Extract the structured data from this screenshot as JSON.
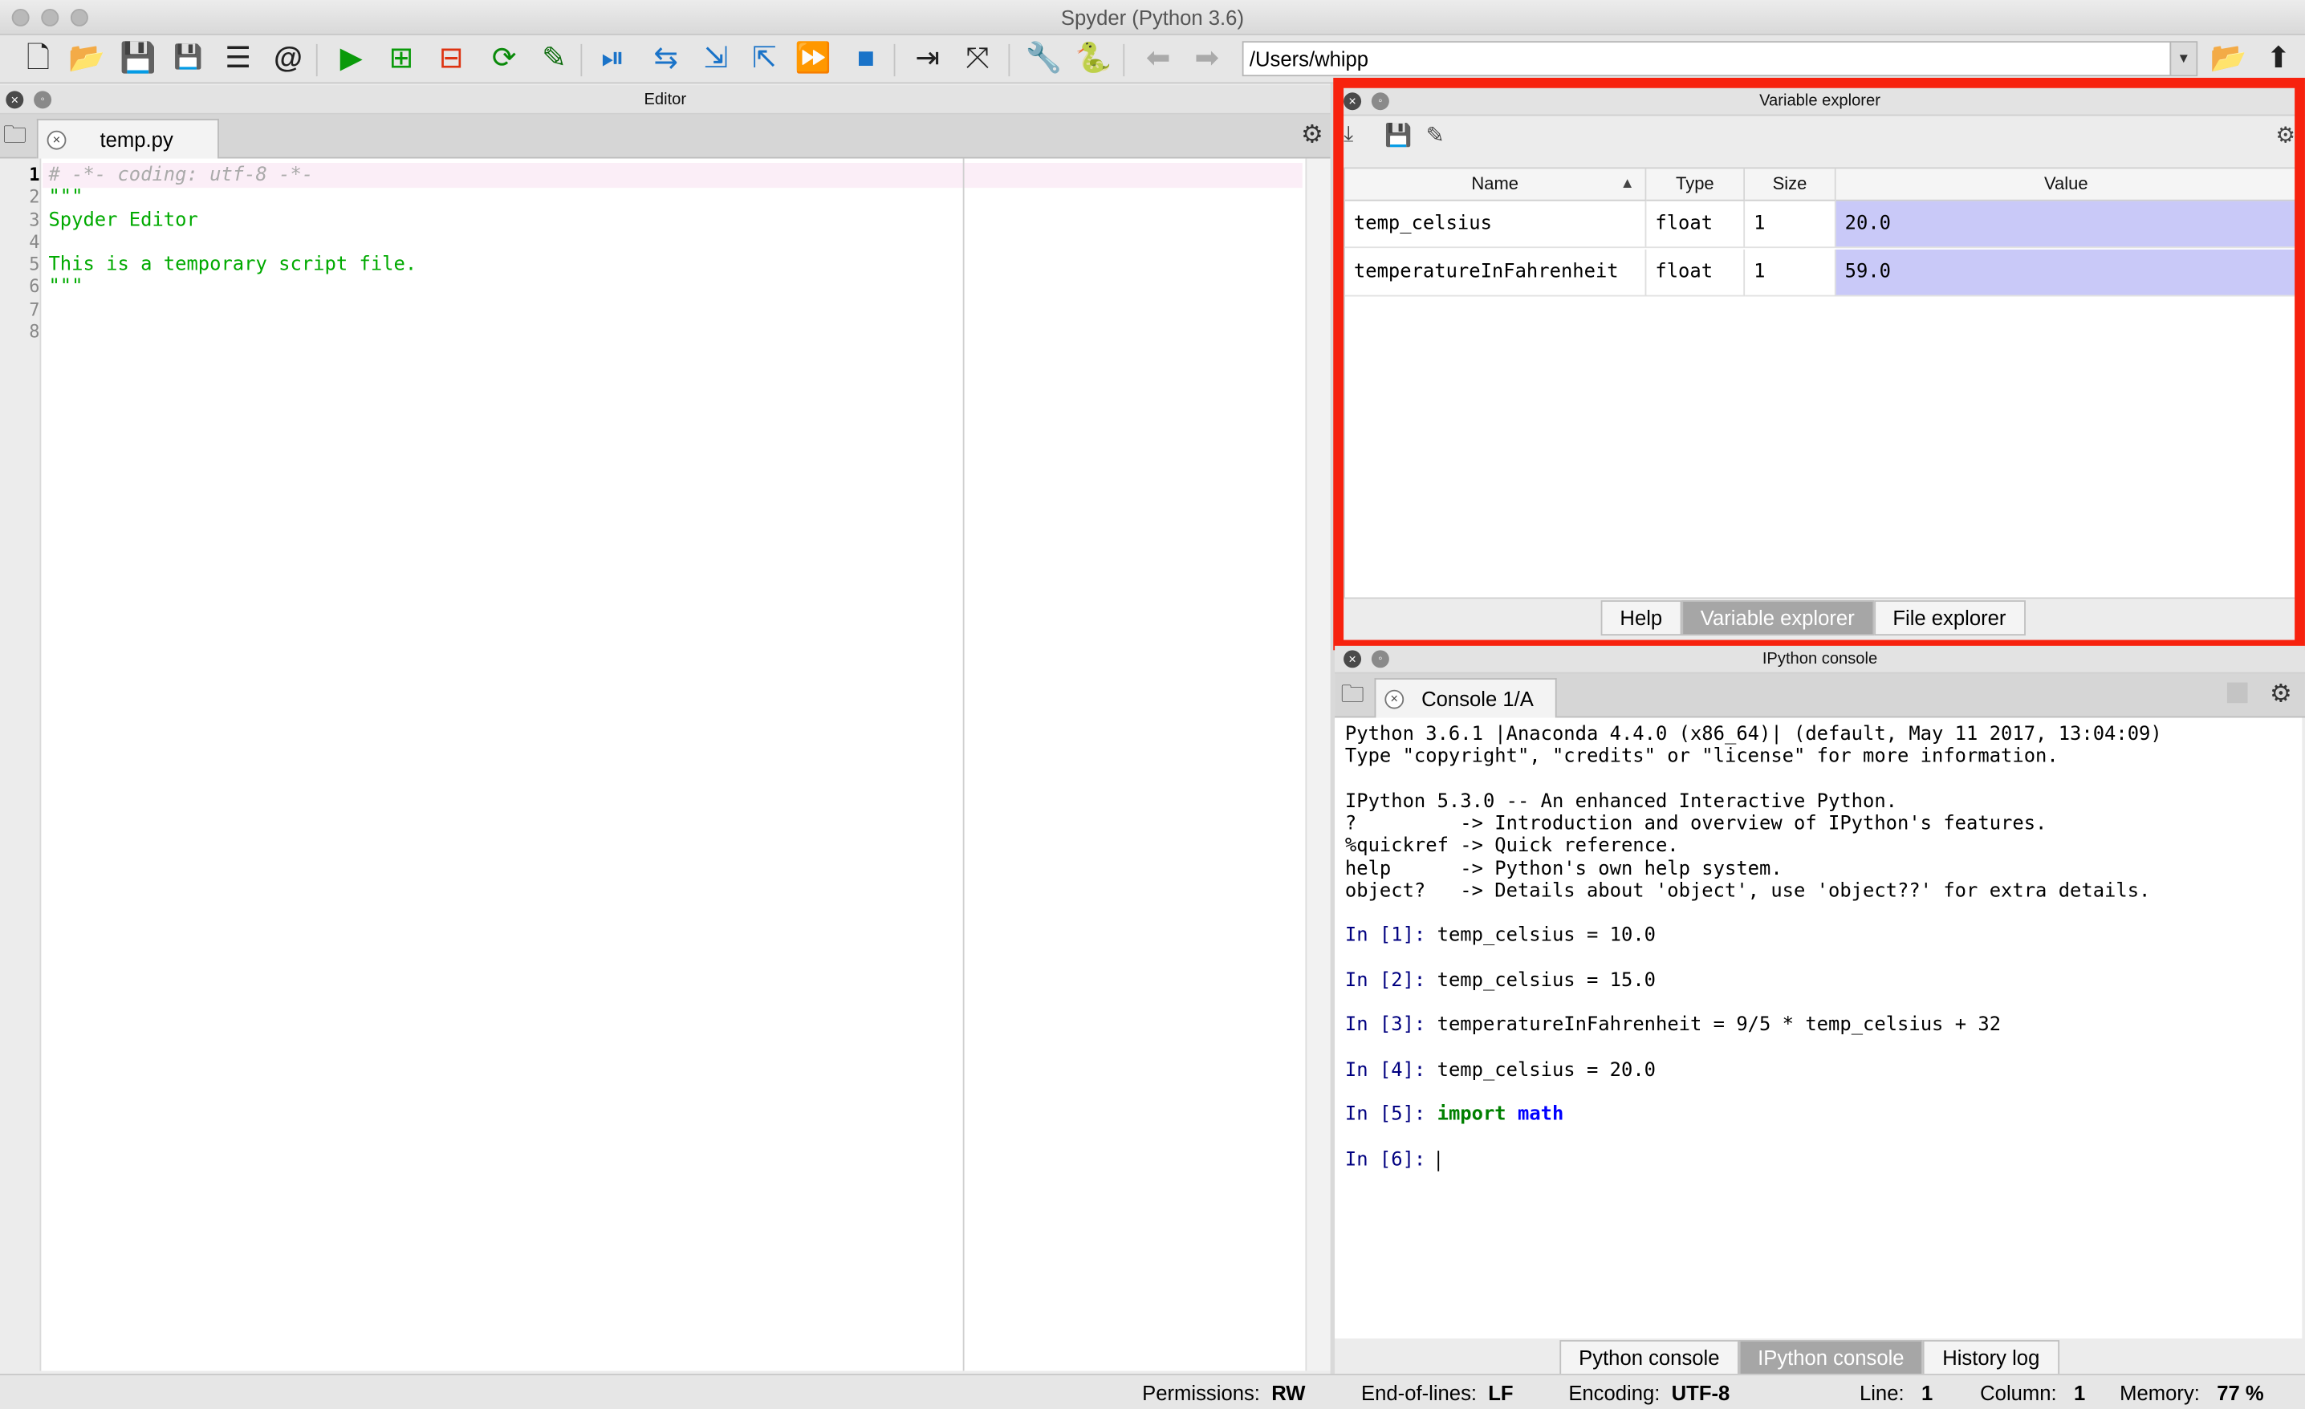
{
  "window": {
    "title": "Spyder (Python 3.6)"
  },
  "toolbar": {
    "path": "/Users/whipp",
    "icons": [
      "new-file-icon",
      "open-file-icon",
      "save-icon",
      "save-all-icon",
      "outline-icon",
      "at-icon",
      "run-icon",
      "run-cell-icon",
      "run-cell-advance-icon",
      "rerun-icon",
      "configure-run-icon",
      "debug-icon",
      "step-icon",
      "step-into-icon",
      "step-return-icon",
      "continue-icon",
      "stop-icon",
      "maximize-pane-icon",
      "fullscreen-icon",
      "wrench-icon",
      "python-icon",
      "back-arrow-icon",
      "forward-arrow-icon",
      "folder-icon",
      "up-arrow-icon"
    ]
  },
  "editor": {
    "pane_title": "Editor",
    "tab_label": "temp.py",
    "line_numbers": [
      "1",
      "2",
      "3",
      "4",
      "5",
      "6",
      "7",
      "8"
    ],
    "lines": [
      {
        "text": "# -*- coding: utf-8 -*-",
        "kind": "comment"
      },
      {
        "text": "\"\"\"",
        "kind": "string"
      },
      {
        "text": "Spyder Editor",
        "kind": "string"
      },
      {
        "text": "",
        "kind": "string"
      },
      {
        "text": "This is a temporary script file.",
        "kind": "string"
      },
      {
        "text": "\"\"\"",
        "kind": "string"
      },
      {
        "text": "",
        "kind": "plain"
      },
      {
        "text": "",
        "kind": "plain"
      }
    ]
  },
  "variable_explorer": {
    "pane_title": "Variable explorer",
    "columns": {
      "name": "Name",
      "sort_indicator": "▲",
      "type": "Type",
      "size": "Size",
      "value": "Value"
    },
    "rows": [
      {
        "name": "temp_celsius",
        "type": "float",
        "size": "1",
        "value": "20.0"
      },
      {
        "name": "temperatureInFahrenheit",
        "type": "float",
        "size": "1",
        "value": "59.0"
      }
    ],
    "tabs": [
      {
        "label": "Help",
        "active": false
      },
      {
        "label": "Variable explorer",
        "active": true
      },
      {
        "label": "File explorer",
        "active": false
      }
    ]
  },
  "console": {
    "pane_title": "IPython console",
    "tab_label": "Console 1/A",
    "banner": [
      "Python 3.6.1 |Anaconda 4.4.0 (x86_64)| (default, May 11 2017, 13:04:09)",
      "Type \"copyright\", \"credits\" or \"license\" for more information.",
      "",
      "IPython 5.3.0 -- An enhanced Interactive Python.",
      "?         -> Introduction and overview of IPython's features.",
      "%quickref -> Quick reference.",
      "help      -> Python's own help system.",
      "object?   -> Details about 'object', use 'object??' for extra details."
    ],
    "inputs": [
      {
        "prompt": "In [1]: ",
        "code": "temp_celsius = 10.0"
      },
      {
        "prompt": "In [2]: ",
        "code": "temp_celsius = 15.0"
      },
      {
        "prompt": "In [3]: ",
        "code": "temperatureInFahrenheit = 9/5 * temp_celsius + 32"
      },
      {
        "prompt": "In [4]: ",
        "code": "temp_celsius = 20.0"
      },
      {
        "prompt": "In [5]: ",
        "keyword": "import",
        "module": "math"
      },
      {
        "prompt": "In [6]: ",
        "code": ""
      }
    ],
    "tabs": [
      {
        "label": "Python console",
        "active": false
      },
      {
        "label": "IPython console",
        "active": true
      },
      {
        "label": "History log",
        "active": false
      }
    ]
  },
  "statusbar": {
    "permissions_label": "Permissions:",
    "permissions_value": "RW",
    "eol_label": "End-of-lines:",
    "eol_value": "LF",
    "encoding_label": "Encoding:",
    "encoding_value": "UTF-8",
    "line_label": "Line:",
    "line_value": "1",
    "column_label": "Column:",
    "column_value": "1",
    "memory_label": "Memory:",
    "memory_value": "77 %"
  },
  "colors": {
    "highlight_frame": "#f7220e",
    "value_cell": "#c9c9f8",
    "string": "#00aa00",
    "comment": "#aaaaaa",
    "prompt": "#000080"
  }
}
